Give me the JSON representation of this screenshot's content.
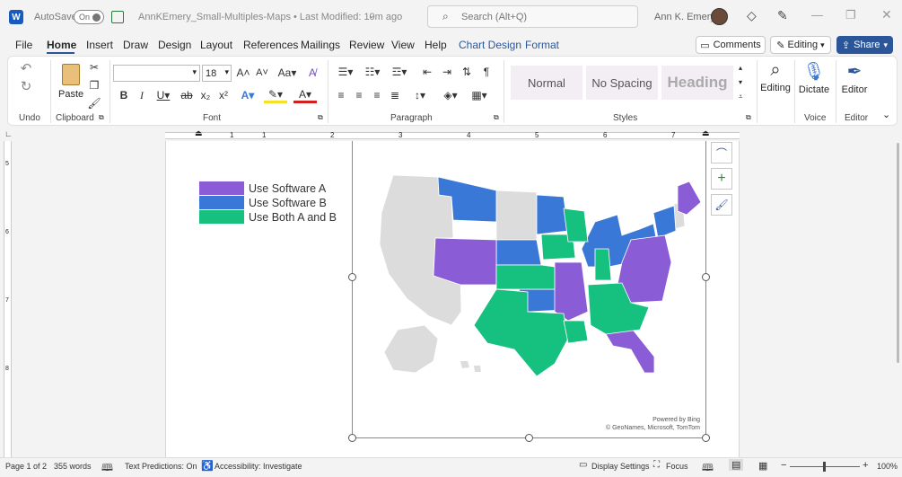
{
  "titlebar": {
    "autosave_label": "AutoSave",
    "autosave_state": "On",
    "doc_title": "AnnKEmery_Small-Multiples-Maps • Last Modified: 10m ago",
    "search_placeholder": "Search (Alt+Q)",
    "user_name": "Ann K. Emery"
  },
  "tabs": [
    "File",
    "Home",
    "Insert",
    "Draw",
    "Design",
    "Layout",
    "References",
    "Mailings",
    "Review",
    "View",
    "Help",
    "Chart Design",
    "Format"
  ],
  "actions": {
    "comments": "Comments",
    "editing": "Editing",
    "share": "Share"
  },
  "ribbon": {
    "undo_label": "Undo",
    "clipboard_label": "Clipboard",
    "paste_label": "Paste",
    "font_label": "Font",
    "font_name": "",
    "font_size": "18",
    "paragraph_label": "Paragraph",
    "styles_label": "Styles",
    "styles": [
      "Normal",
      "No Spacing",
      "Heading"
    ],
    "editing_label": "Editing",
    "dictate_label": "Dictate",
    "voice_label": "Voice",
    "editor_btn_label": "Editor",
    "editor_label": "Editor"
  },
  "ruler_numbers": [
    "1",
    "1",
    "2",
    "3",
    "4",
    "5",
    "6",
    "7"
  ],
  "vruler_numbers": [
    "5",
    "6",
    "7",
    "8"
  ],
  "legend": [
    {
      "label": "Use Software A",
      "color": "#8a5cd6"
    },
    {
      "label": "Use Software B",
      "color": "#3a78d8"
    },
    {
      "label": "Use Both A and B",
      "color": "#16c07f"
    }
  ],
  "map_credit_1": "Powered by Bing",
  "map_credit_2": "© GeoNames, Microsoft, TomTom",
  "status": {
    "page": "Page 1 of 2",
    "words": "355 words",
    "predictions": "Text Predictions: On",
    "accessibility": "Accessibility: Investigate",
    "display": "Display Settings",
    "focus": "Focus",
    "zoom": "100%"
  },
  "colors": {
    "grey_state": "#dcdcdc",
    "accent": "#2b579a"
  }
}
